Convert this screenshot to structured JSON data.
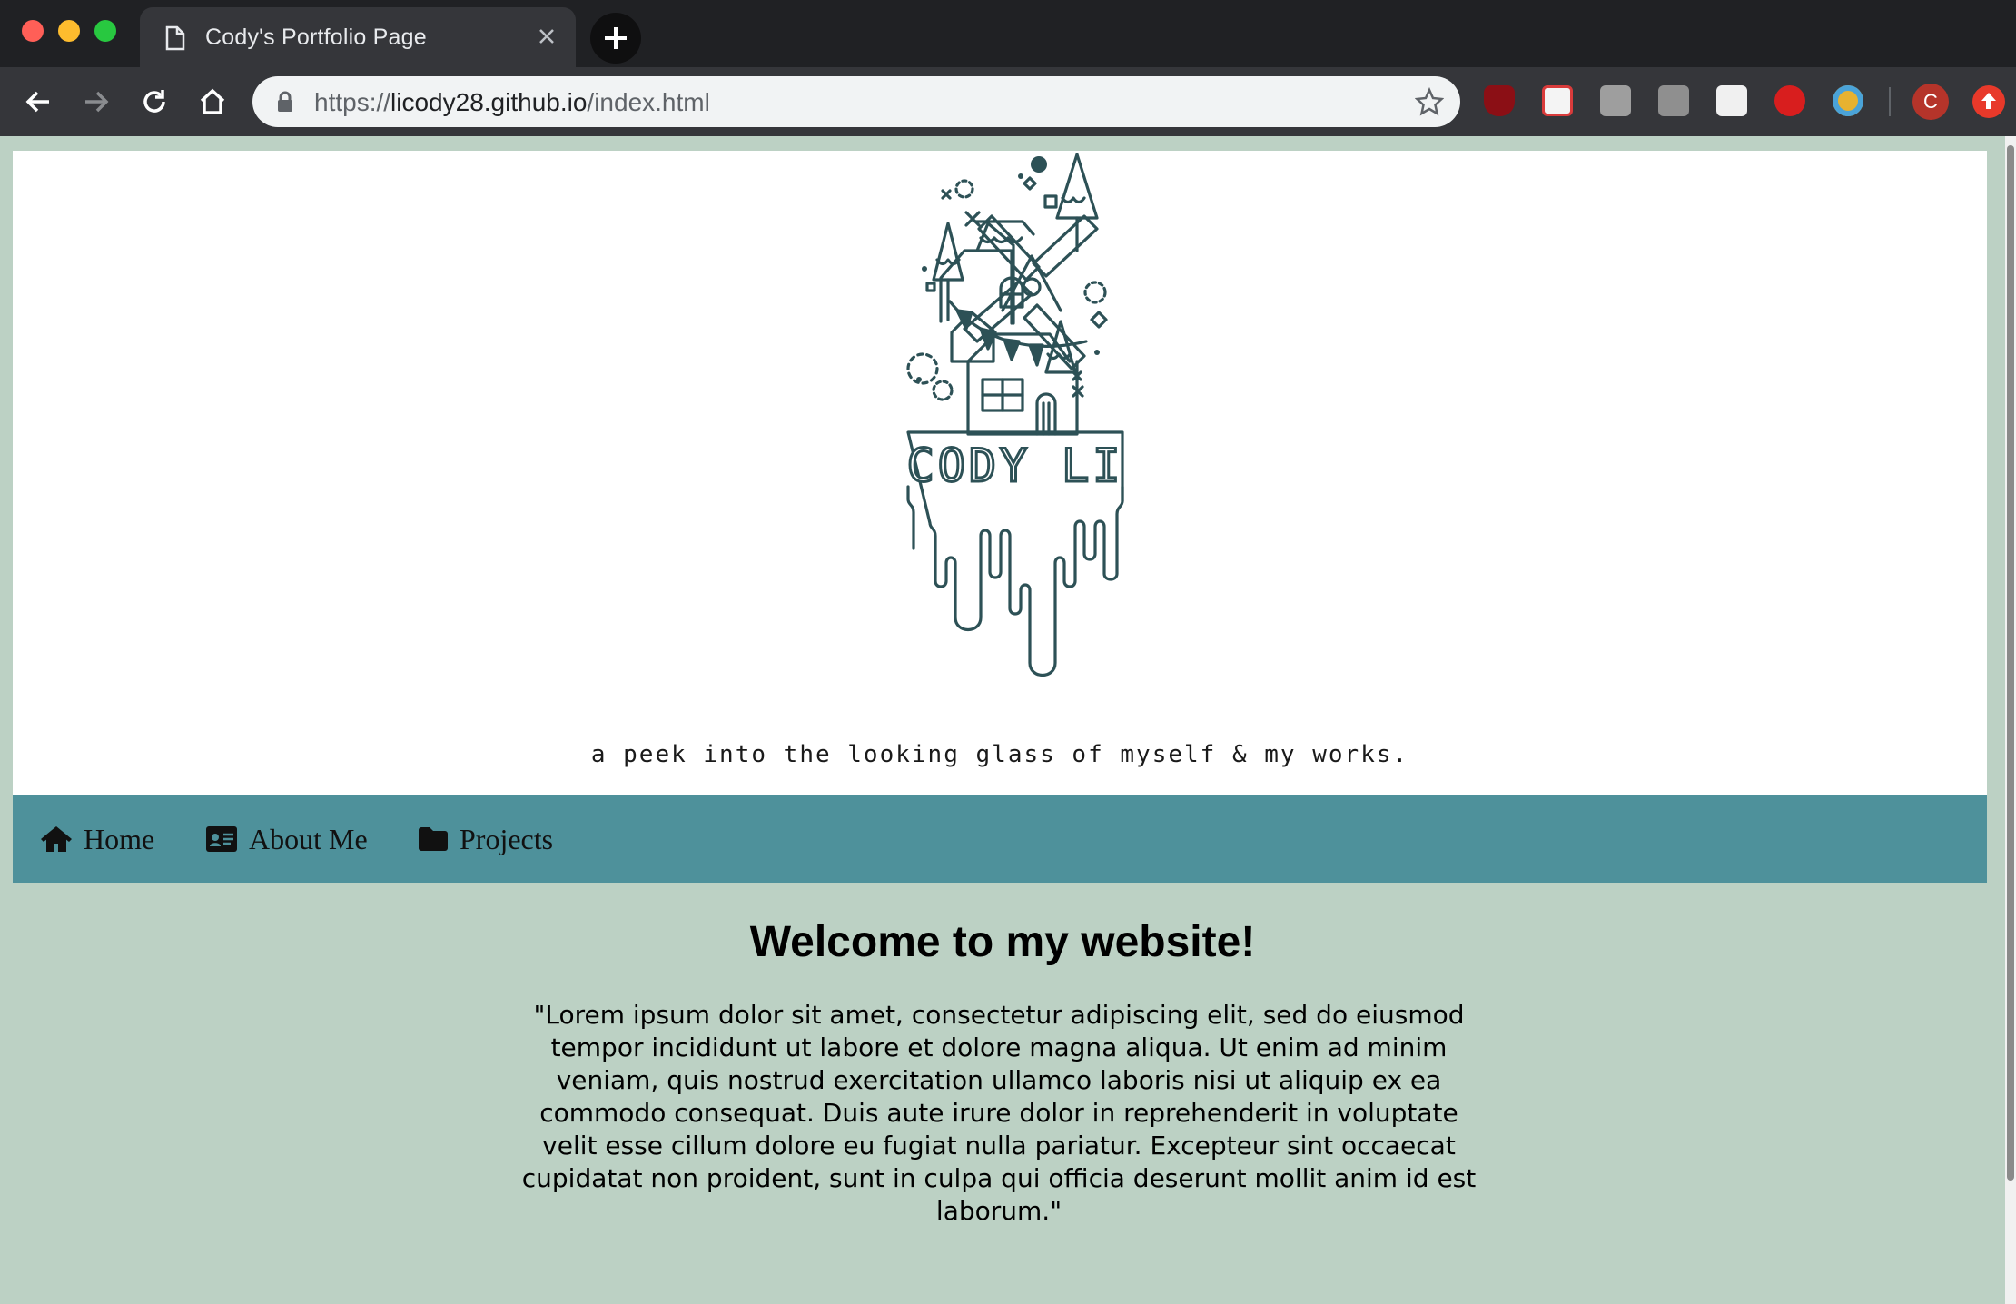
{
  "browser": {
    "tab_title": "Cody's Portfolio Page",
    "url_scheme": "https://",
    "url_host": "licody28.github.io",
    "url_path": "/index.html",
    "profile_initial": "C",
    "extensions": [
      "ublock-icon",
      "mail-icon",
      "nx-icon",
      "hypothesis-icon",
      "reader-icon",
      "adblock-icon",
      "globe-icon"
    ]
  },
  "hero": {
    "logo_text": "CODY LI",
    "tagline": "a peek into the looking glass of myself & my works."
  },
  "nav": {
    "items": [
      {
        "label": "Home",
        "icon": "home-icon"
      },
      {
        "label": "About Me",
        "icon": "id-card-icon"
      },
      {
        "label": "Projects",
        "icon": "folder-icon"
      }
    ]
  },
  "main": {
    "heading": "Welcome to my website!",
    "body": "\"Lorem ipsum dolor sit amet, consectetur adipiscing elit, sed do eiusmod tempor incididunt ut labore et dolore magna aliqua. Ut enim ad minim veniam, quis nostrud exercitation ullamco laboris nisi ut aliquip ex ea commodo consequat. Duis aute irure dolor in reprehenderit in voluptate velit esse cillum dolore eu fugiat nulla pariatur. Excepteur sint occaecat cupidatat non proident, sunt in culpa qui officia deserunt mollit anim id est laborum.\""
  },
  "colors": {
    "page_bg": "#bcd1c4",
    "nav_bg": "#4e919b",
    "logo_stroke": "#2d5156"
  }
}
